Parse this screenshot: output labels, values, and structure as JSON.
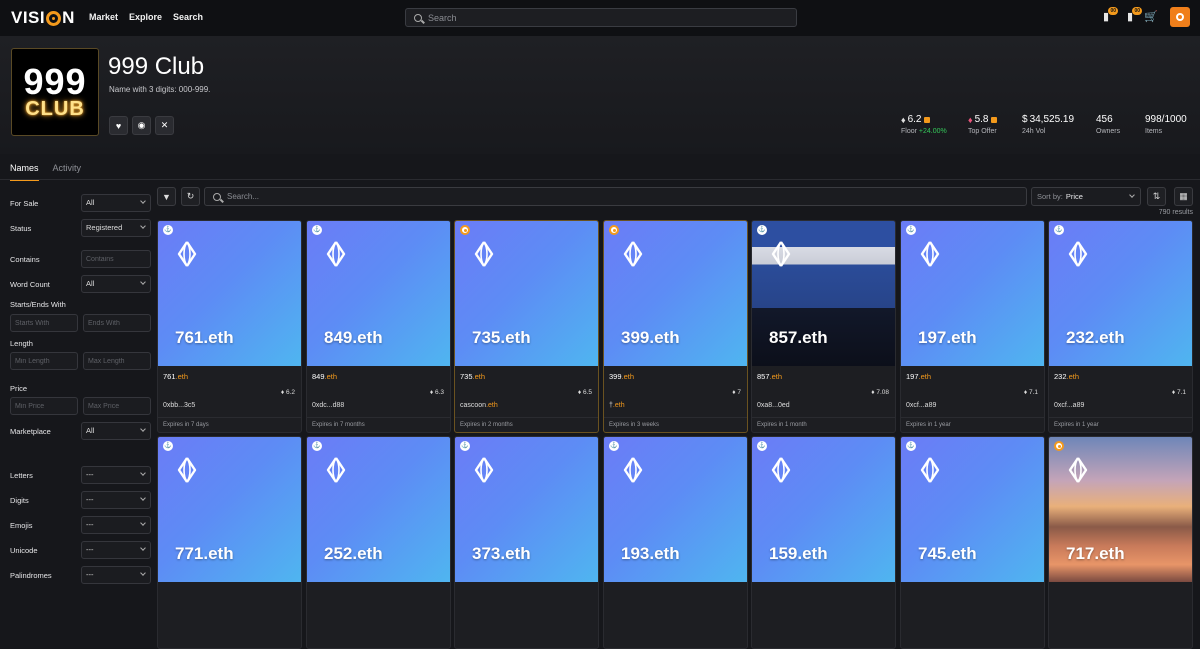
{
  "nav": {
    "logo_left": "VISI",
    "logo_right": "N",
    "links": [
      "Market",
      "Explore",
      "Search"
    ],
    "search_placeholder": "Search",
    "notif_badge_1": "00",
    "notif_badge_2": "00"
  },
  "collection": {
    "logo_number": "999",
    "logo_word": "CLUB",
    "title": "999 Club",
    "subtitle": "Name with 3 digits: 000-999.",
    "stats": {
      "floor_value": "6.2",
      "floor_label": "Floor",
      "floor_change": "+24.00%",
      "top_offer_value": "5.8",
      "top_offer_label": "Top Offer",
      "vol_value": "34,525.19",
      "vol_label": "24h Vol",
      "owners_value": "456",
      "owners_label": "Owners",
      "items_value": "998/1000",
      "items_label": "Items"
    }
  },
  "tabs": [
    "Names",
    "Activity"
  ],
  "filters": {
    "for_sale": {
      "label": "For Sale",
      "value": "All"
    },
    "status": {
      "label": "Status",
      "value": "Registered"
    },
    "contains": {
      "label": "Contains",
      "placeholder": "Contains"
    },
    "word_count": {
      "label": "Word Count",
      "value": "All"
    },
    "starts_ends": {
      "label": "Starts/Ends With",
      "starts_placeholder": "Starts With",
      "ends_placeholder": "Ends With"
    },
    "length": {
      "label": "Length",
      "min_placeholder": "Min Length",
      "max_placeholder": "Max Length"
    },
    "price": {
      "label": "Price",
      "min_placeholder": "Min Price",
      "max_placeholder": "Max Price"
    },
    "marketplace": {
      "label": "Marketplace",
      "value": "All"
    },
    "letters": {
      "label": "Letters",
      "value": "---"
    },
    "digits": {
      "label": "Digits",
      "value": "---"
    },
    "emojis": {
      "label": "Emojis",
      "value": "---"
    },
    "unicode": {
      "label": "Unicode",
      "value": "---"
    },
    "palindromes": {
      "label": "Palindromes",
      "value": "---"
    }
  },
  "toolbar": {
    "search_placeholder": "Search...",
    "sort_label": "Sort by:",
    "sort_value": "Price",
    "results": "790 results"
  },
  "cards": [
    {
      "name": "761.eth",
      "base": "761",
      "tld": ".eth",
      "price": "6.2",
      "owner": "0xbb...3c5",
      "owner_tld": "",
      "expires": "Expires in 7 days",
      "mk": "ens"
    },
    {
      "name": "849.eth",
      "base": "849",
      "tld": ".eth",
      "price": "6.3",
      "owner": "0xdc...d88",
      "owner_tld": "",
      "expires": "Expires in 7 months",
      "mk": "ens"
    },
    {
      "name": "735.eth",
      "base": "735",
      "tld": ".eth",
      "price": "6.5",
      "owner": "cascoon",
      "owner_tld": ".eth",
      "expires": "Expires in 2 months",
      "mk": "vision"
    },
    {
      "name": "399.eth",
      "base": "399",
      "tld": ".eth",
      "price": "7",
      "owner": "†",
      "owner_tld": ".eth",
      "expires": "Expires in 3 weeks",
      "mk": "vision"
    },
    {
      "name": "857.eth",
      "base": "857",
      "tld": ".eth",
      "price": "7.08",
      "owner": "0xa8...0ed",
      "owner_tld": "",
      "expires": "Expires in 1 month",
      "mk": "ens"
    },
    {
      "name": "197.eth",
      "base": "197",
      "tld": ".eth",
      "price": "7.1",
      "owner": "0xcf...a89",
      "owner_tld": "",
      "expires": "Expires in 1 year",
      "mk": "ens"
    },
    {
      "name": "232.eth",
      "base": "232",
      "tld": ".eth",
      "price": "7.1",
      "owner": "0xcf...a89",
      "owner_tld": "",
      "expires": "Expires in 1 year",
      "mk": "ens"
    },
    {
      "name": "771.eth",
      "mk": "ens"
    },
    {
      "name": "252.eth",
      "mk": "ens"
    },
    {
      "name": "373.eth",
      "mk": "ens"
    },
    {
      "name": "193.eth",
      "mk": "ens"
    },
    {
      "name": "159.eth",
      "mk": "ens"
    },
    {
      "name": "745.eth",
      "mk": "ens"
    },
    {
      "name": "717.eth",
      "mk": "vision"
    }
  ],
  "colors": {
    "accent": "#f49a1c",
    "positive": "#34c759",
    "offer": "#e8547a"
  }
}
